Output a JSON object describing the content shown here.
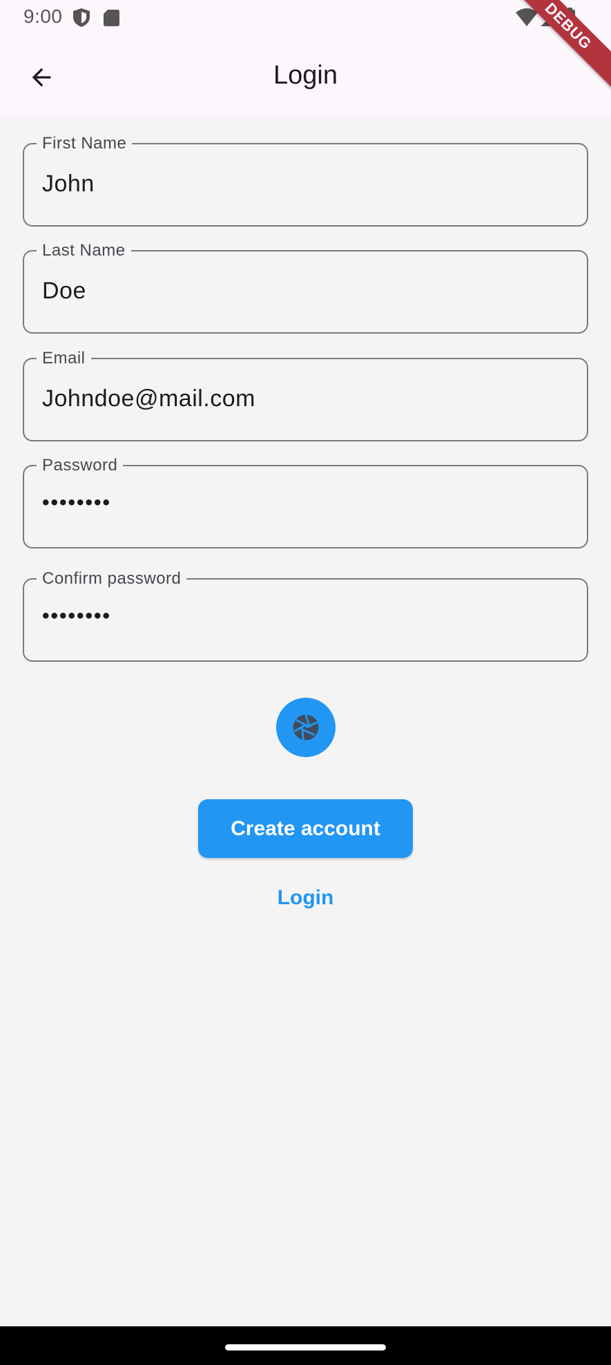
{
  "status_bar": {
    "time": "9:00",
    "left_icons": [
      "shield-icon",
      "sd-card-icon"
    ],
    "right_icons": [
      "wifi-icon",
      "signal-icon",
      "battery-icon"
    ]
  },
  "debug_banner": "DEBUG",
  "app_bar": {
    "title": "Login",
    "back_icon": "arrow-back-icon"
  },
  "form": {
    "first_name": {
      "label": "First Name",
      "value": "John"
    },
    "last_name": {
      "label": "Last Name",
      "value": "Doe"
    },
    "email": {
      "label": "Email",
      "value": "Johndoe@mail.com"
    },
    "password": {
      "label": "Password",
      "value": "••••••••"
    },
    "confirm_password": {
      "label": "Confirm password",
      "value": "••••••••"
    }
  },
  "camera_icon": "camera-shutter-icon",
  "actions": {
    "create_account": "Create account",
    "login": "Login"
  },
  "colors": {
    "accent": "#2196f3",
    "app_bar_bg": "#fdf7fd",
    "page_bg": "#f4f4f4",
    "debug_banner": "#b3333f"
  }
}
